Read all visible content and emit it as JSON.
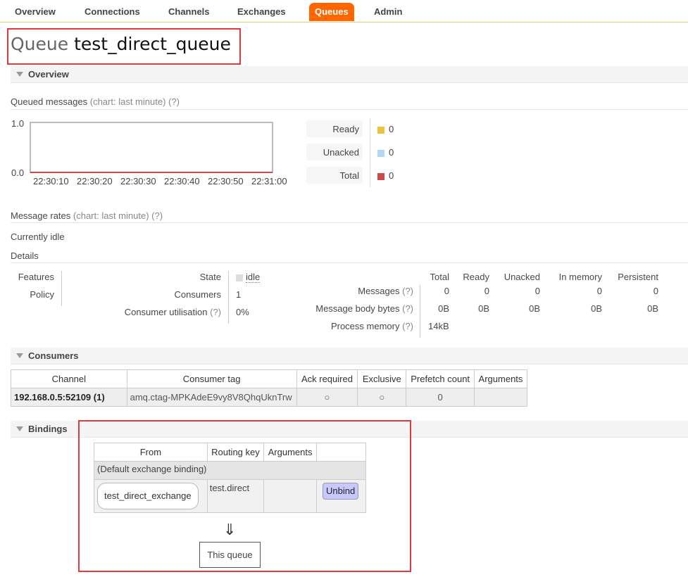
{
  "nav": {
    "items": [
      "Overview",
      "Connections",
      "Channels",
      "Exchanges",
      "Queues",
      "Admin"
    ],
    "active": "Queues"
  },
  "title": {
    "prefix": "Queue",
    "name": "test_direct_queue"
  },
  "overview": {
    "heading": "Overview",
    "queued_messages_label": "Queued messages",
    "chart_hint": "(chart: last minute)",
    "help": "(?)",
    "legend": [
      {
        "label": "Ready",
        "value": "0",
        "color": "#edc240"
      },
      {
        "label": "Unacked",
        "value": "0",
        "color": "#afd8f8"
      },
      {
        "label": "Total",
        "value": "0",
        "color": "#cb4b4b"
      }
    ],
    "message_rates_label": "Message rates",
    "currently_idle": "Currently idle",
    "details_label": "Details",
    "features_label": "Features",
    "policy_label": "Policy",
    "state_label": "State",
    "state_value": "idle",
    "consumers_label": "Consumers",
    "consumers_value": "1",
    "consumer_util_label": "Consumer utilisation",
    "consumer_util_value": "0%",
    "stats_headers": [
      "Total",
      "Ready",
      "Unacked",
      "In memory",
      "Persistent"
    ],
    "stats_rows": [
      {
        "label": "Messages",
        "values": [
          "0",
          "0",
          "0",
          "0",
          "0"
        ]
      },
      {
        "label": "Message body bytes",
        "values": [
          "0B",
          "0B",
          "0B",
          "0B",
          "0B"
        ]
      },
      {
        "label": "Process memory",
        "values": [
          "14kB",
          "",
          "",
          "",
          ""
        ]
      }
    ]
  },
  "chart_data": {
    "type": "line",
    "x": [
      "22:30:10",
      "22:30:20",
      "22:30:30",
      "22:30:40",
      "22:30:50",
      "22:31:00"
    ],
    "series": [
      {
        "name": "Ready",
        "values": [
          0,
          0,
          0,
          0,
          0,
          0
        ]
      },
      {
        "name": "Unacked",
        "values": [
          0,
          0,
          0,
          0,
          0,
          0
        ]
      },
      {
        "name": "Total",
        "values": [
          0,
          0,
          0,
          0,
          0,
          0
        ]
      }
    ],
    "y_ticks": [
      "1.0",
      "0.0"
    ],
    "ylim": [
      0,
      1
    ],
    "title": "",
    "xlabel": "",
    "ylabel": ""
  },
  "consumers": {
    "heading": "Consumers",
    "headers": [
      "Channel",
      "Consumer tag",
      "Ack required",
      "Exclusive",
      "Prefetch count",
      "Arguments"
    ],
    "rows": [
      {
        "channel": "192.168.0.5:52109 (1)",
        "tag": "amq.ctag-MPKAdeE9vy8V8QhqUknTrw",
        "ack": "○",
        "exclusive": "○",
        "prefetch": "0",
        "arguments": ""
      }
    ]
  },
  "bindings": {
    "heading": "Bindings",
    "headers": [
      "From",
      "Routing key",
      "Arguments",
      ""
    ],
    "default_row": "(Default exchange binding)",
    "rows": [
      {
        "from": "test_direct_exchange",
        "routing_key": "test.direct",
        "arguments": "",
        "action": "Unbind"
      }
    ],
    "arrow": "⇓",
    "this_queue": "This queue"
  }
}
